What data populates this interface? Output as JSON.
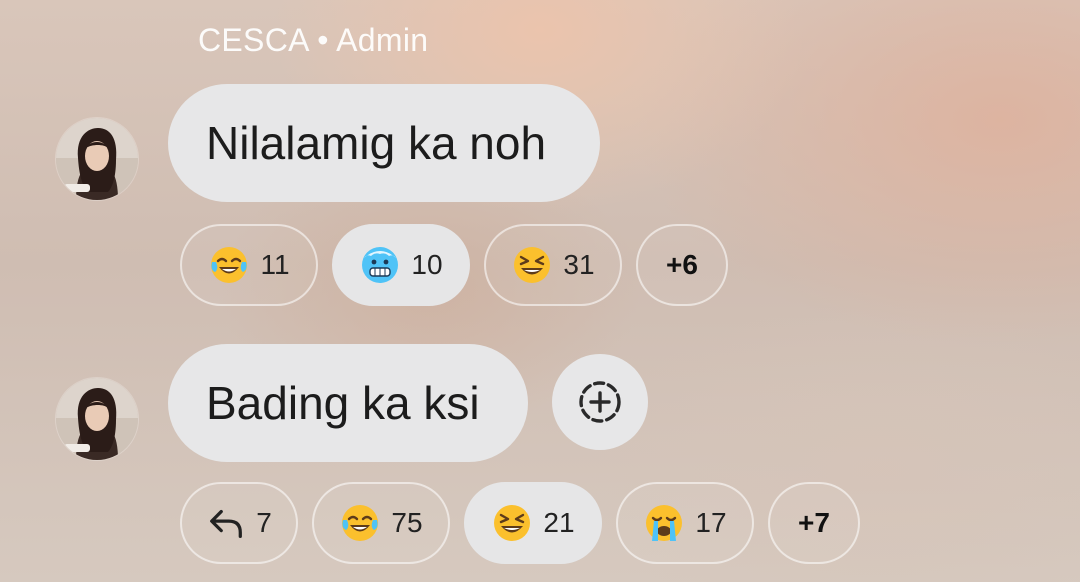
{
  "sender": {
    "name": "CESCA",
    "separator": "•",
    "role": "Admin"
  },
  "messages": [
    {
      "text": "Nilalamig ka noh",
      "reactions": [
        {
          "icon": "tears-of-joy-emoji",
          "count": "11",
          "selected": false
        },
        {
          "icon": "cold-face-emoji",
          "count": "10",
          "selected": true
        },
        {
          "icon": "grinning-squinting-face-emoji",
          "count": "31",
          "selected": false
        },
        {
          "more": "+6"
        }
      ]
    },
    {
      "text": "Bading ka ksi",
      "add_reaction_icon": "add-reaction-icon",
      "reactions": [
        {
          "icon": "reply-icon",
          "count": "7",
          "selected": false
        },
        {
          "icon": "tears-of-joy-emoji",
          "count": "75",
          "selected": false
        },
        {
          "icon": "grinning-squinting-face-emoji",
          "count": "21",
          "selected": true
        },
        {
          "icon": "loudly-crying-face-emoji",
          "count": "17",
          "selected": false
        },
        {
          "more": "+7"
        }
      ]
    }
  ],
  "colors": {
    "bubble": "#e7e7e8",
    "selected_chip": "#e6e6e7",
    "emoji_yellow": "#fbc02d"
  }
}
